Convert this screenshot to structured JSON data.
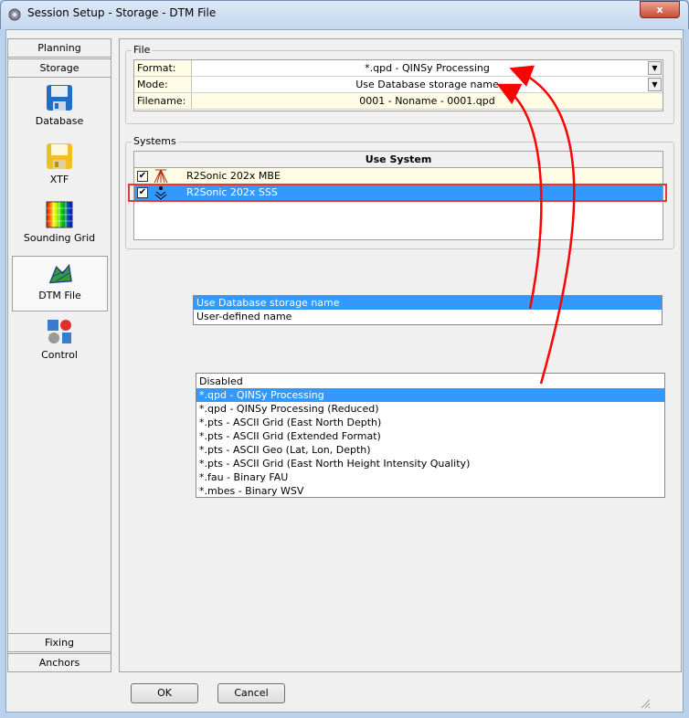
{
  "window": {
    "title": "Session Setup - Storage -  DTM File",
    "close": "x"
  },
  "sidebar": {
    "top_buttons": [
      "Planning",
      "Storage"
    ],
    "items": [
      {
        "label": "Database",
        "icon": "floppy-disk-icon"
      },
      {
        "label": "XTF",
        "icon": "floppy-disk-yellow-icon"
      },
      {
        "label": "Sounding Grid",
        "icon": "sounding-grid-icon"
      },
      {
        "label": "DTM File",
        "icon": "dtm-file-icon",
        "selected": true
      },
      {
        "label": "Control",
        "icon": "control-icon"
      }
    ],
    "bottom_buttons": [
      "Fixing",
      "Anchors"
    ]
  },
  "file": {
    "group_label": "File",
    "rows": [
      {
        "label": "Format:",
        "value": "*.qpd - QINSy Processing"
      },
      {
        "label": "Mode:",
        "value": "Use Database storage name"
      },
      {
        "label": "Filename:",
        "value": "0001 - Noname - 0001.qpd"
      }
    ]
  },
  "systems": {
    "group_label": "Systems",
    "header": "Use System",
    "rows": [
      {
        "name": "R2Sonic 202x MBE",
        "checked": true,
        "icon": "multibeam-icon"
      },
      {
        "name": "R2Sonic 202x SSS",
        "checked": true,
        "icon": "sidescan-icon",
        "selected": true
      }
    ],
    "check_mark": "✔"
  },
  "mode_options": {
    "items": [
      "Use Database storage name",
      "User-defined name"
    ],
    "selected": 0
  },
  "format_options": {
    "items": [
      "Disabled",
      "*.qpd - QINSy Processing",
      "*.qpd - QINSy Processing (Reduced)",
      "*.pts - ASCII Grid (East North Depth)",
      "*.pts - ASCII Grid (Extended Format)",
      "*.pts - ASCII Geo  (Lat, Lon,  Depth)",
      "*.pts - ASCII Grid (East North Height Intensity Quality)",
      "*.fau - Binary FAU",
      "*.mbes - Binary WSV"
    ],
    "selected": 1
  },
  "buttons": {
    "ok": "OK",
    "cancel": "Cancel"
  },
  "colors": {
    "selection": "#3399ff",
    "highlight_box": "#e53935",
    "arrow": "#ff0000",
    "label_bg": "#fffde6"
  }
}
